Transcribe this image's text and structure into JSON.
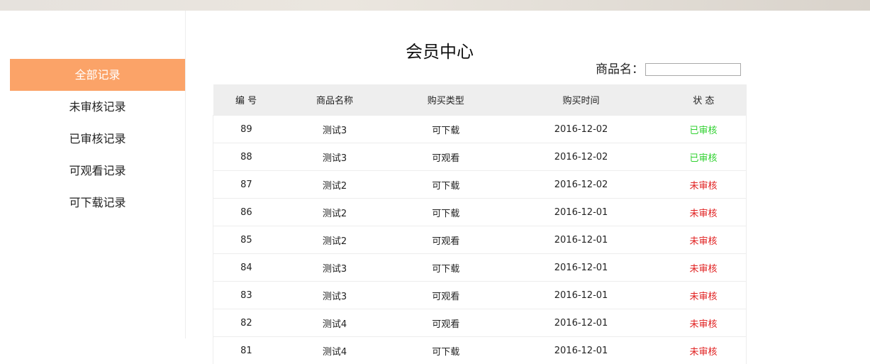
{
  "sidebar": {
    "items": [
      {
        "label": "全部记录",
        "active": true
      },
      {
        "label": "未审核记录",
        "active": false
      },
      {
        "label": "已审核记录",
        "active": false
      },
      {
        "label": "可观看记录",
        "active": false
      },
      {
        "label": "可下载记录",
        "active": false
      }
    ]
  },
  "main": {
    "title": "会员中心",
    "search": {
      "label": "商品名：",
      "value": "",
      "placeholder": ""
    },
    "table": {
      "headers": [
        "编 号",
        "商品名称",
        "购买类型",
        "购买时间",
        "状 态"
      ],
      "rows": [
        {
          "id": "89",
          "name": "测试3",
          "type": "可下载",
          "time": "2016-12-02",
          "status": "已审核",
          "approved": true
        },
        {
          "id": "88",
          "name": "测试3",
          "type": "可观看",
          "time": "2016-12-02",
          "status": "已审核",
          "approved": true
        },
        {
          "id": "87",
          "name": "测试2",
          "type": "可下载",
          "time": "2016-12-02",
          "status": "未审核",
          "approved": false
        },
        {
          "id": "86",
          "name": "测试2",
          "type": "可下载",
          "time": "2016-12-01",
          "status": "未审核",
          "approved": false
        },
        {
          "id": "85",
          "name": "测试2",
          "type": "可观看",
          "time": "2016-12-01",
          "status": "未审核",
          "approved": false
        },
        {
          "id": "84",
          "name": "测试3",
          "type": "可下载",
          "time": "2016-12-01",
          "status": "未审核",
          "approved": false
        },
        {
          "id": "83",
          "name": "测试3",
          "type": "可观看",
          "time": "2016-12-01",
          "status": "未审核",
          "approved": false
        },
        {
          "id": "82",
          "name": "测试4",
          "type": "可观看",
          "time": "2016-12-01",
          "status": "未审核",
          "approved": false
        },
        {
          "id": "81",
          "name": "测试4",
          "type": "可下载",
          "time": "2016-12-01",
          "status": "未审核",
          "approved": false
        }
      ]
    }
  },
  "colors": {
    "active_menu": "#fba368",
    "approved": "#2fd12f",
    "pending": "#e02020",
    "header_bg": "#eeeeee"
  }
}
